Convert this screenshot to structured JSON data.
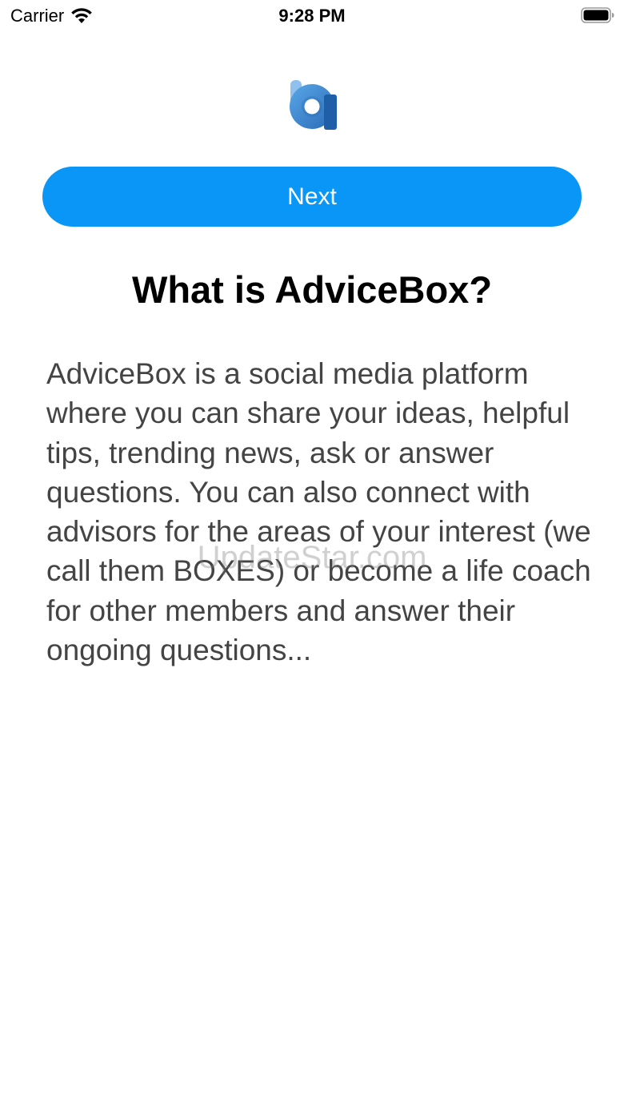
{
  "status_bar": {
    "carrier": "Carrier",
    "time": "9:28 PM",
    "icons": [
      "wifi-icon",
      "battery-icon"
    ]
  },
  "logo": {
    "icon": "advicebox-logo-icon",
    "colors": {
      "primary": "#3a8ad6",
      "dark": "#1f5ea8",
      "inner": "#ffffff"
    }
  },
  "onboarding": {
    "next_label": "Next",
    "title": "What is AdviceBox?",
    "description": "AdviceBox is a social media platform where you can share your ideas, helpful tips, trending news, ask or answer questions. You can also connect with advisors for the areas of your interest (we call them BOXES) or become a life coach for other members and answer their ongoing questions..."
  },
  "watermark": "UpdateStar.com",
  "colors": {
    "accent": "#0a96f7",
    "text_primary": "#000000",
    "text_secondary": "#444444",
    "background": "#ffffff"
  }
}
